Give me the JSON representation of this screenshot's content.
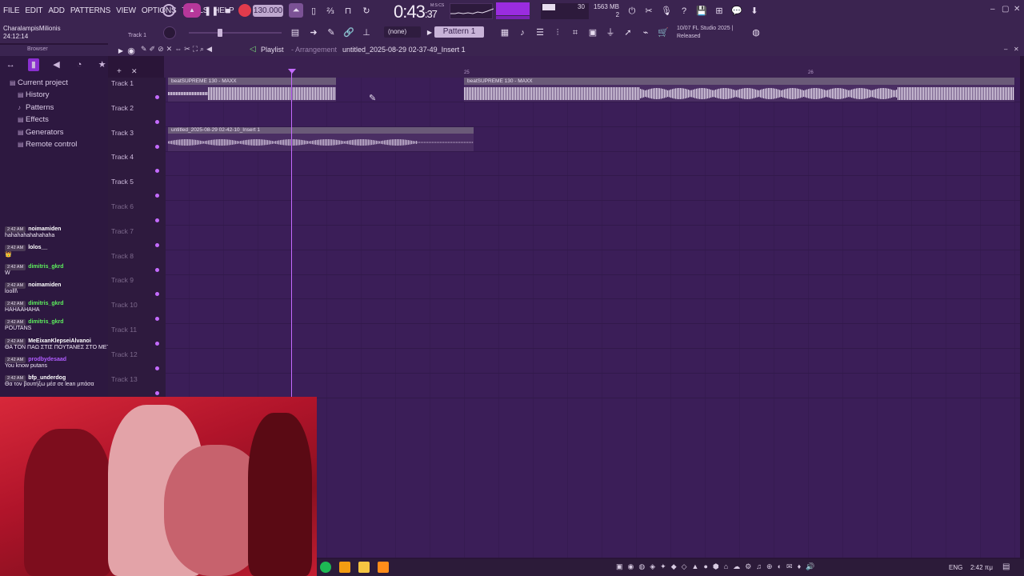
{
  "menu": [
    "FILE",
    "EDIT",
    "ADD",
    "PATTERNS",
    "VIEW",
    "OPTIONS",
    "TOOLS",
    "HELP"
  ],
  "transport": {
    "tempo": "130.000",
    "time_main": "0:43",
    "time_frac": ":37",
    "time_unit": "M:S:CS"
  },
  "perf": {
    "cpu": "30",
    "mem": "1563 MB",
    "poly": "2"
  },
  "user": {
    "name": "CharalampisMilionis",
    "clock": "24:12:14",
    "track_hint": "Track 1"
  },
  "toolbar2": {
    "none_label": "(none)",
    "pattern": "Pattern 1"
  },
  "news": {
    "line1": "10/07  FL Studio 2025 |",
    "line2": "Released"
  },
  "browser": {
    "title": "Browser",
    "items": [
      {
        "label": "Current project",
        "sub": false
      },
      {
        "label": "History",
        "sub": true
      },
      {
        "label": "Patterns",
        "sub": true
      },
      {
        "label": "Effects",
        "sub": true
      },
      {
        "label": "Generators",
        "sub": true
      },
      {
        "label": "Remote control",
        "sub": true
      }
    ]
  },
  "playlist": {
    "title": "Playlist",
    "arrow": "- Arrangement",
    "file": "untitled_2025-08-29 02-37-49_Insert 1",
    "ruler": [
      "25",
      "26"
    ],
    "tracks": [
      "Track 1",
      "Track 2",
      "Track 3",
      "Track 4",
      "Track 5",
      "Track 6",
      "Track 7",
      "Track 8",
      "Track 9",
      "Track 10",
      "Track 11",
      "Track 12",
      "Track 13"
    ],
    "clips": [
      {
        "label": "beatSUPREME 130 - MAXX",
        "track": 1
      },
      {
        "label": "beatSUPREME 130 - MAXX",
        "track": 1
      },
      {
        "label": "untitled_2025-08-29 02-42-10_Insert 1",
        "track": 3
      }
    ]
  },
  "chat": [
    {
      "time": "2:42 AM",
      "user": "noimamiden",
      "color": "#ffffff",
      "text": "hahahahahahahaha"
    },
    {
      "time": "2:42 AM",
      "user": "lolos__",
      "color": "#ffffff",
      "text": "👑"
    },
    {
      "time": "2:42 AM",
      "user": "dimitris_gkrd",
      "color": "#5df05d",
      "text": "W"
    },
    {
      "time": "2:42 AM",
      "user": "noimamiden",
      "color": "#ffffff",
      "text": "loolll\\"
    },
    {
      "time": "2:42 AM",
      "user": "dimitris_gkrd",
      "color": "#5df05d",
      "text": "HAHAAHAHA"
    },
    {
      "time": "2:42 AM",
      "user": "dimitris_gkrd",
      "color": "#5df05d",
      "text": "POUTANS"
    },
    {
      "time": "2:42 AM",
      "user": "MeEixanKlepseiAlvanoi",
      "color": "#ffffff",
      "text": "ΘΑ ΤΟΝ ΠΑΩ ΣΤΙΣ ΠΟΥΤΑΝΕΣ ΣΤΟ ΜΕΤΑΞΟΥΡΓΕΙΟ"
    },
    {
      "time": "2:42 AM",
      "user": "prodbydesaad",
      "color": "#b05cff",
      "text": "You know putans"
    },
    {
      "time": "2:42 AM",
      "user": "bfp_underdog",
      "color": "#ffffff",
      "text": "Θα τον βουτήξω μέσ σε lean μπάσα"
    }
  ],
  "taskbar": {
    "lang": "ENG",
    "clock": "2:42 πμ"
  },
  "colors": {
    "accent": "#9a2ce0",
    "playhead": "#c46bff",
    "grid": "#3b1e58"
  }
}
